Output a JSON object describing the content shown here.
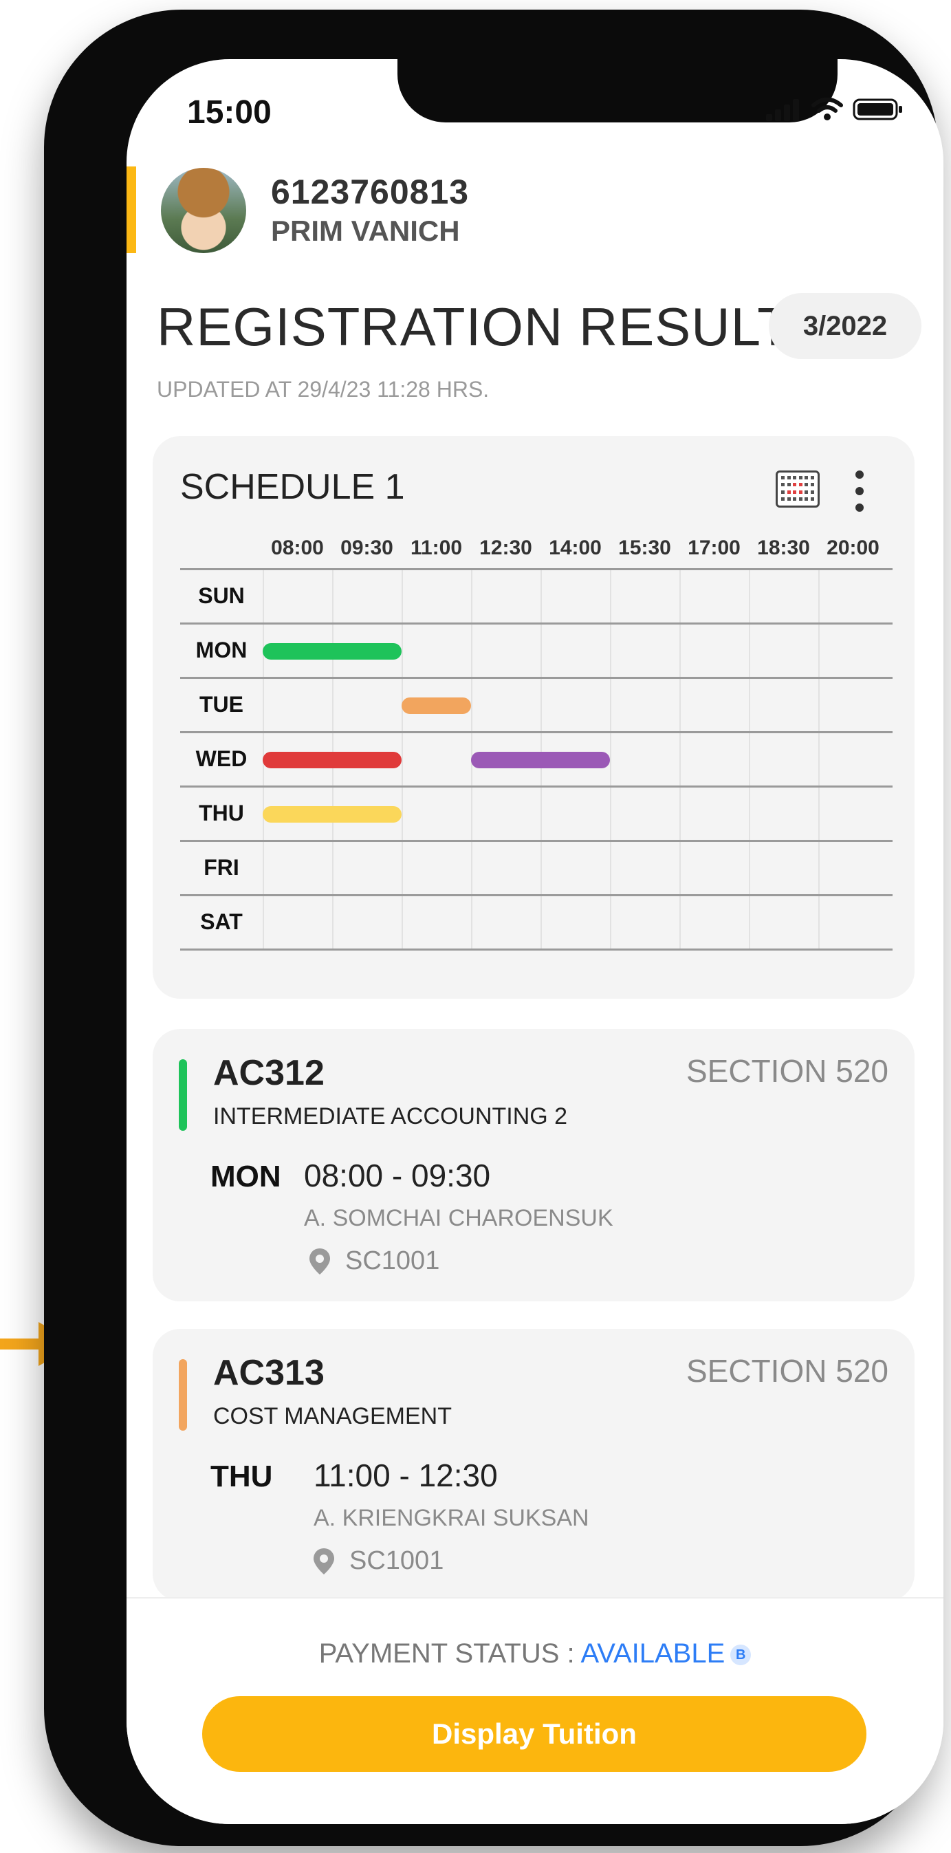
{
  "status_bar": {
    "time": "15:00"
  },
  "profile": {
    "student_id": "6123760813",
    "name": "PRIM VANICH"
  },
  "header": {
    "title": "REGISTRATION RESULT",
    "term": "3/2022",
    "updated": "UPDATED AT 29/4/23 11:28 HRS."
  },
  "schedule": {
    "title": "SCHEDULE 1",
    "times": [
      "08:00",
      "09:30",
      "11:00",
      "12:30",
      "14:00",
      "15:30",
      "17:00",
      "18:30",
      "20:00"
    ],
    "days": [
      "SUN",
      "MON",
      "TUE",
      "WED",
      "THU",
      "FRI",
      "SAT"
    ],
    "blocks": [
      {
        "day": "MON",
        "start": "08:00",
        "end": "11:00",
        "color": "#1ec35a"
      },
      {
        "day": "TUE",
        "start": "11:00",
        "end": "12:30",
        "color": "#f2a55e"
      },
      {
        "day": "WED",
        "start": "08:00",
        "end": "11:00",
        "color": "#e03a3a"
      },
      {
        "day": "WED",
        "start": "12:30",
        "end": "15:30",
        "color": "#9b59b6"
      },
      {
        "day": "THU",
        "start": "08:00",
        "end": "11:00",
        "color": "#fbd75a"
      }
    ]
  },
  "courses": [
    {
      "code": "AC312",
      "section": "SECTION 520",
      "name": "INTERMEDIATE ACCOUNTING 2",
      "day": "MON",
      "time": "08:00 - 09:30",
      "teacher": "A. SOMCHAI CHAROENSUK",
      "room": "SC1001",
      "color": "#1ec35a"
    },
    {
      "code": "AC313",
      "section": "SECTION 520",
      "name": "COST MANAGEMENT",
      "day": "THU",
      "time": "11:00 - 12:30",
      "teacher": "A. KRIENGKRAI SUKSAN",
      "room": "SC1001",
      "color": "#f2a55e"
    }
  ],
  "footer": {
    "payment_label": "PAYMENT STATUS : ",
    "payment_value": "AVAILABLE",
    "badge": "B",
    "button_label": "Display Tuition"
  },
  "colors": {
    "accent": "#fcb814",
    "link": "#2d7df6"
  }
}
